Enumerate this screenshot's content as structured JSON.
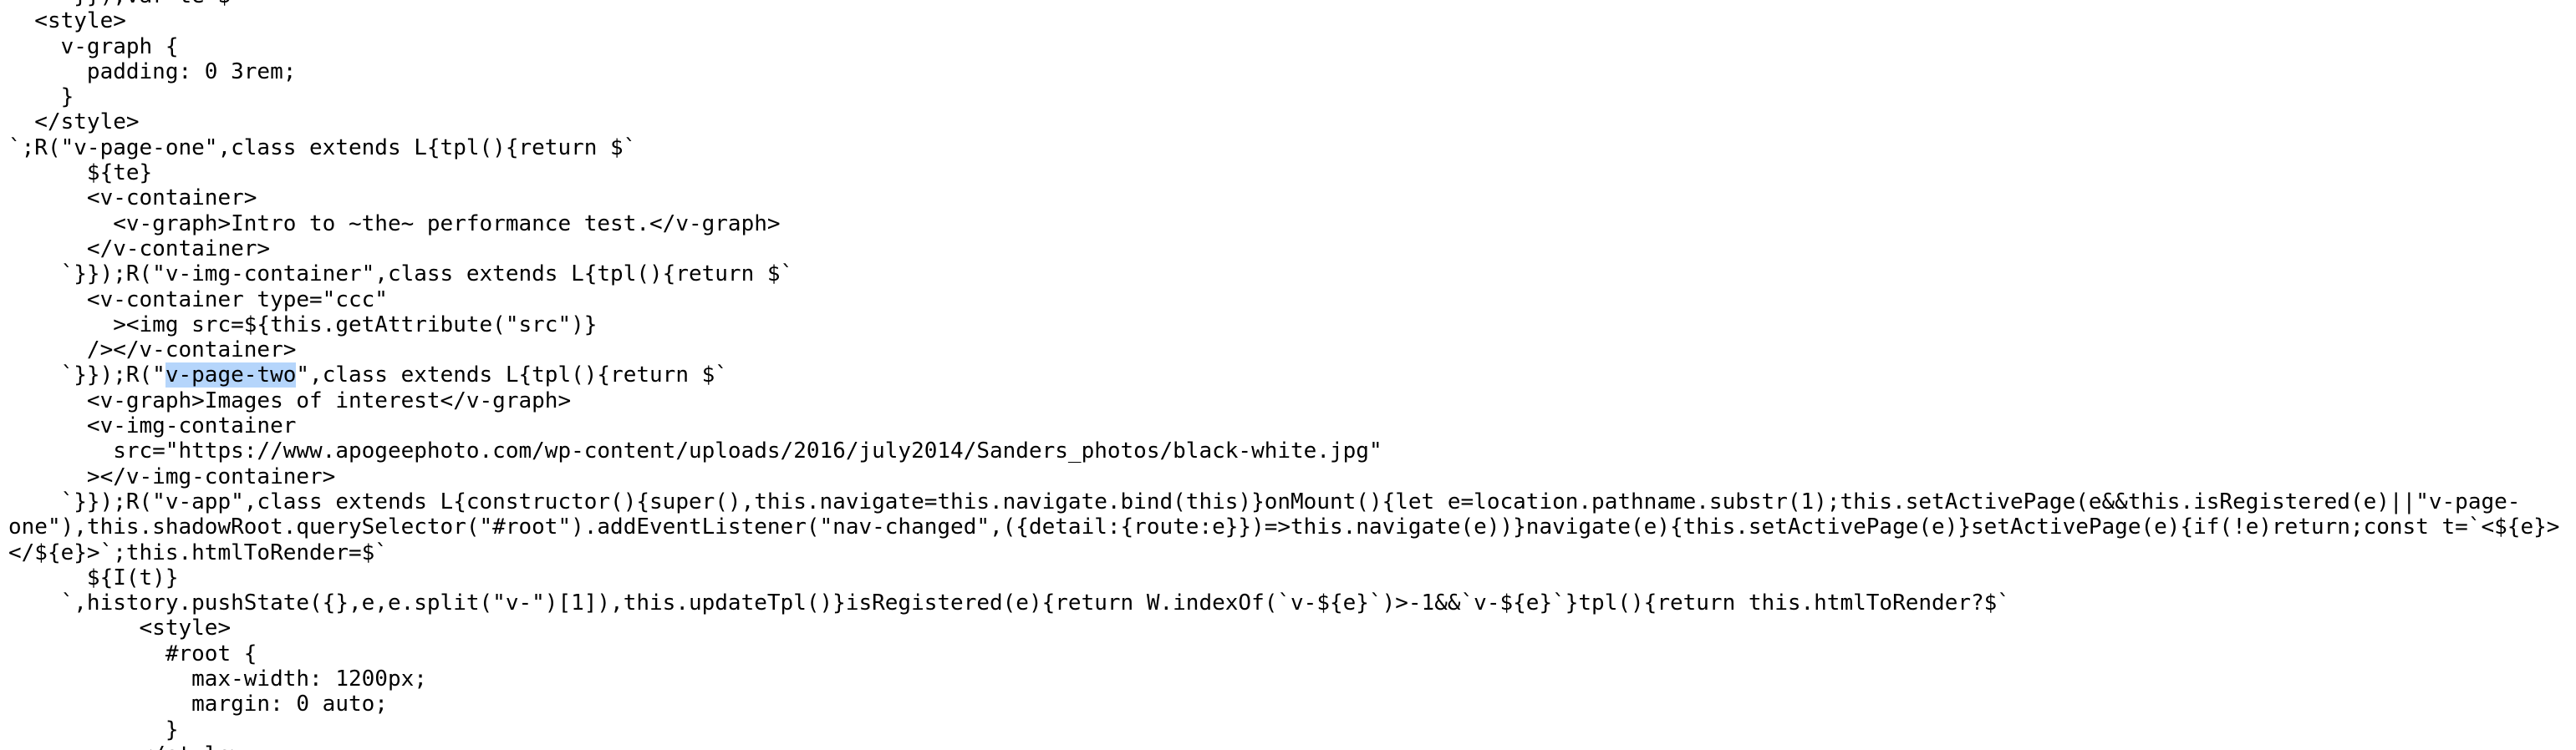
{
  "window": {
    "title": ""
  },
  "source_view": {
    "highlight_text": "v-page-two",
    "lines": [
      "     }});var te=$`",
      "  <style>",
      "    v-graph {",
      "      padding: 0 3rem;",
      "    }",
      "  </style>",
      "`;R(\"v-page-one\",class extends L{tpl(){return $`",
      "      ${te}",
      "      <v-container>",
      "        <v-graph>Intro to ~the~ performance test.</v-graph>",
      "      </v-container>",
      "    `}});R(\"v-img-container\",class extends L{tpl(){return $`",
      "      <v-container type=\"ccc\"",
      "        ><img src=${this.getAttribute(\"src\")}",
      "      /></v-container>",
      "    `}});R(\"v-page-two\",class extends L{tpl(){return $`",
      "      <v-graph>Images of interest</v-graph>",
      "      <v-img-container",
      "        src=\"https://www.apogeephoto.com/wp-content/uploads/2016/july2014/Sanders_photos/black-white.jpg\"",
      "      ></v-img-container>",
      "    `}});R(\"v-app\",class extends L{constructor(){super(),this.navigate=this.navigate.bind(this)}onMount(){let e=location.pathname.substr(1);this.setActivePage(e&&this.isRegistered(e)||\"v-page-",
      "one\"),this.shadowRoot.querySelector(\"#root\").addEventListener(\"nav-changed\",({detail:{route:e}})=>this.navigate(e))}navigate(e){this.setActivePage(e)}setActivePage(e){if(!e)return;const t=`<${e}>",
      "</${e}>`;this.htmlToRender=$`",
      "      ${I(t)}",
      "    `,history.pushState({},e,e.split(\"v-\")[1]),this.updateTpl()}isRegistered(e){return W.indexOf(`v-${e}`)>-1&&`v-${e}`}tpl(){return this.htmlToRender?$`",
      "          <style>",
      "            #root {",
      "              max-width: 1200px;",
      "              margin: 0 auto;",
      "            }",
      "          </style>"
    ]
  }
}
